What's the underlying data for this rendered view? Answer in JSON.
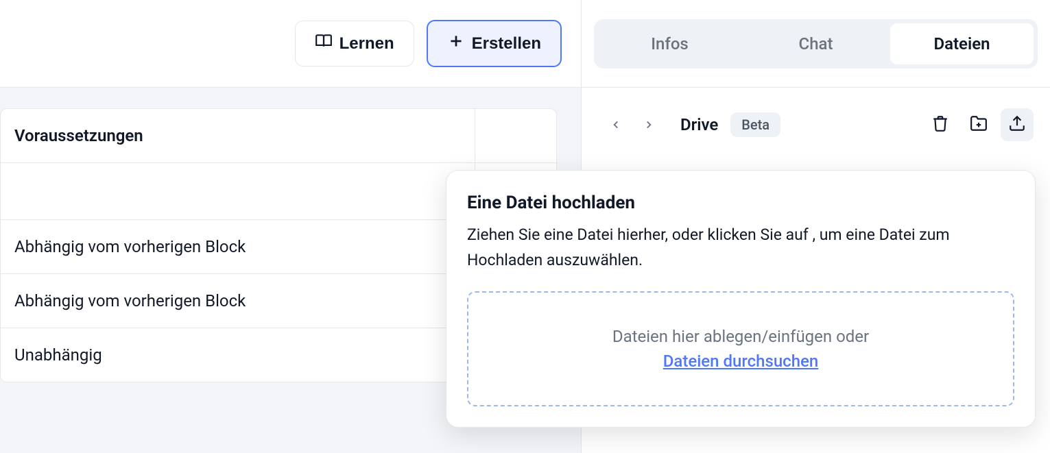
{
  "left": {
    "buttons": {
      "learn": "Lernen",
      "create": "Erstellen"
    },
    "table": {
      "header": "Voraussetzungen",
      "rows": [
        "Abhängig vom vorherigen Block",
        "Abhängig vom vorherigen Block",
        "Unabhängig"
      ]
    }
  },
  "right": {
    "tabs": {
      "infos": "Infos",
      "chat": "Chat",
      "files": "Dateien"
    },
    "drive": {
      "label": "Drive",
      "badge": "Beta"
    }
  },
  "popover": {
    "title": "Eine Datei hochladen",
    "desc": "Ziehen Sie eine Datei hierher, oder klicken Sie auf , um eine Datei zum Hochladen auszuwählen.",
    "dropzone_text": "Dateien hier ablegen/einfügen oder",
    "dropzone_link": "Dateien durchsuchen"
  }
}
